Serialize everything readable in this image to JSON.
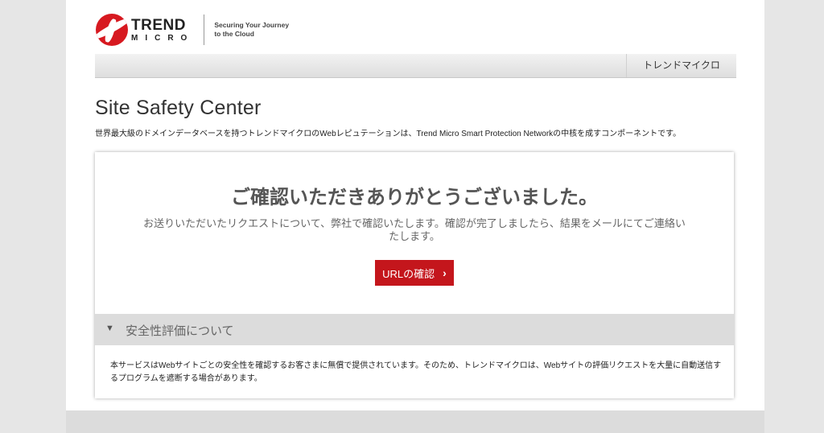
{
  "header": {
    "logo_trend": "TREND",
    "logo_micro": "MICRO",
    "tagline_line1": "Securing Your Journey",
    "tagline_line2": "to the Cloud"
  },
  "nav": {
    "link_label": "トレンドマイクロ"
  },
  "main": {
    "title": "Site Safety Center",
    "description": "世界最大級のドメインデータベースを持つトレンドマイクロのWebレピュテーションは、Trend Micro Smart Protection Networkの中核を成すコンポーネントです。"
  },
  "card": {
    "heading": "ご確認いただきありがとうございました。",
    "message": "お送りいただいたリクエストについて、弊社で確認いたします。確認が完了しましたら、結果をメールにてご連絡いたします。",
    "button_label": "URLの確認",
    "button_chevron": "›",
    "accordion_arrow": "▼",
    "accordion_title": "安全性評価について",
    "accordion_body": "本サービスはWebサイトごとの安全性を確認するお客さまに無償で提供されています。そのため、トレンドマイクロは、Webサイトの評価リクエストを大量に自動送信するプログラムを遮断する場合があります。"
  },
  "colors": {
    "brand_red": "#c4161c",
    "background": "#e6e6e6",
    "accordion_bg": "#dcdcdc"
  }
}
